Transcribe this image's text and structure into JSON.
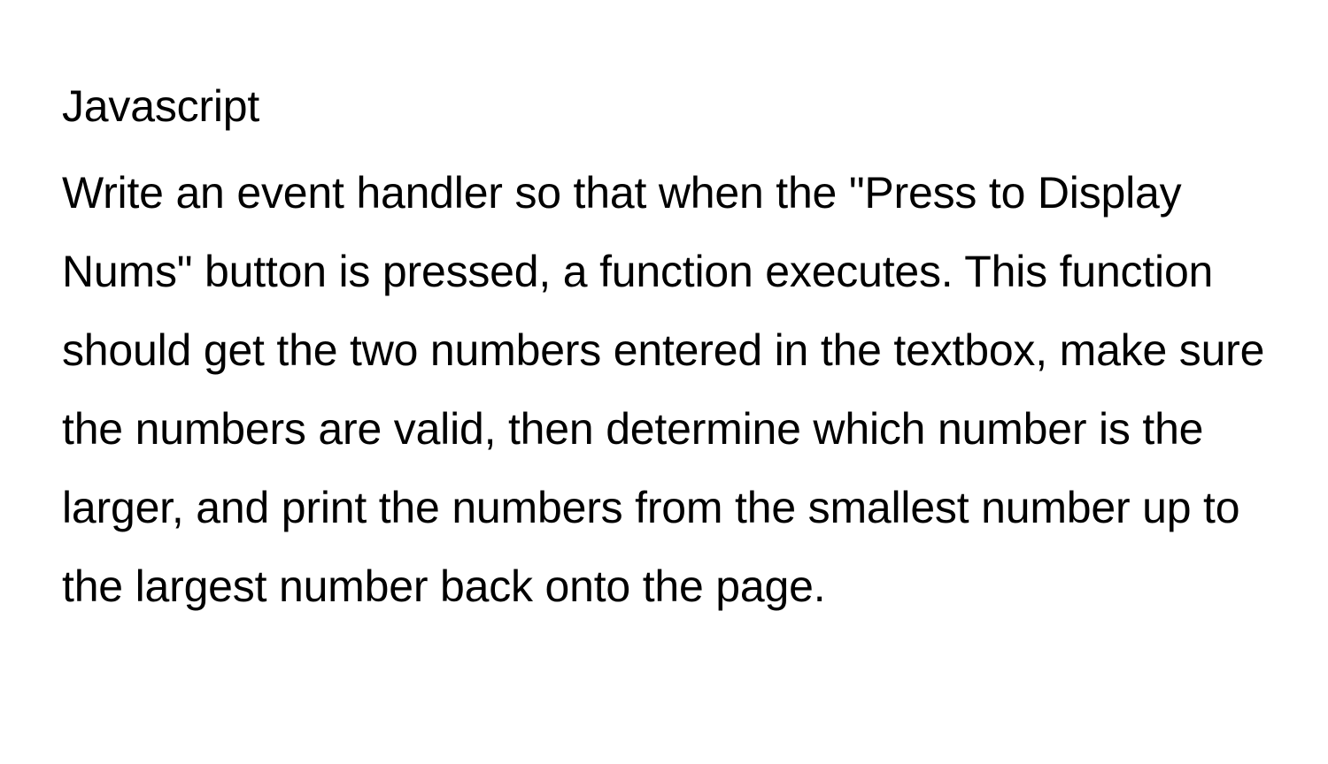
{
  "document": {
    "heading": "Javascript",
    "body": "Write an event handler so that when the \"Press to Display Nums\" button is pressed, a function executes. This function should get the two numbers entered in the textbox, make sure the numbers are valid, then determine which number is the larger, and print the numbers from the smallest number up to the largest number back onto the page."
  }
}
